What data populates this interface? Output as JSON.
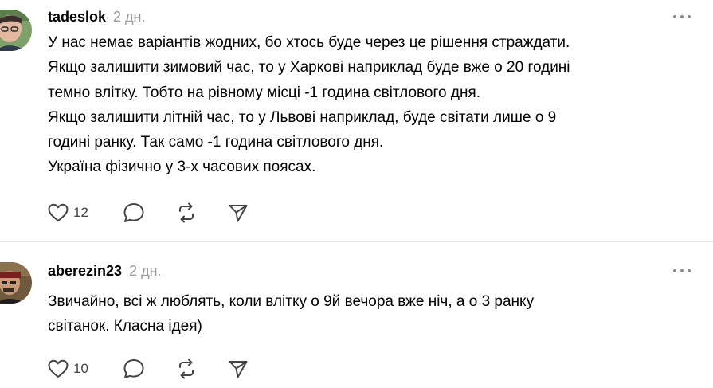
{
  "posts": [
    {
      "username": "tadeslok",
      "time": "2 дн.",
      "lines": [
        "У нас немає варіантів жодних, бо хтось буде через це рішення страждати.",
        "Якщо залишити зимовий час, то у Харкові наприклад буде вже о 20 годині",
        "темно влітку. Тобто на рівному місці -1 година світлового дня.",
        "Якщо залишити літній час, то у Львові наприклад, буде світати лише о 9",
        "годині ранку. Так само -1 година світлового дня.",
        "Україна фізично у 3-х часових поясах."
      ],
      "likes": "12",
      "icons": {
        "like": "heart-icon",
        "reply": "comment-icon",
        "repost": "repost-icon",
        "share": "send-icon",
        "more": "more-icon"
      }
    },
    {
      "username": "aberezin23",
      "time": "2 дн.",
      "lines": [
        "Звичайно, всі ж люблять, коли влітку о 9й вечора вже ніч, а о 3 ранку",
        "світанок. Класна ідея)"
      ],
      "likes": "10",
      "icons": {
        "like": "heart-icon",
        "reply": "comment-icon",
        "repost": "repost-icon",
        "share": "send-icon",
        "more": "more-icon"
      }
    }
  ],
  "colors": {
    "text": "#000000",
    "muted": "#999999",
    "icon": "#444444",
    "divider": "#e5e5e5"
  }
}
